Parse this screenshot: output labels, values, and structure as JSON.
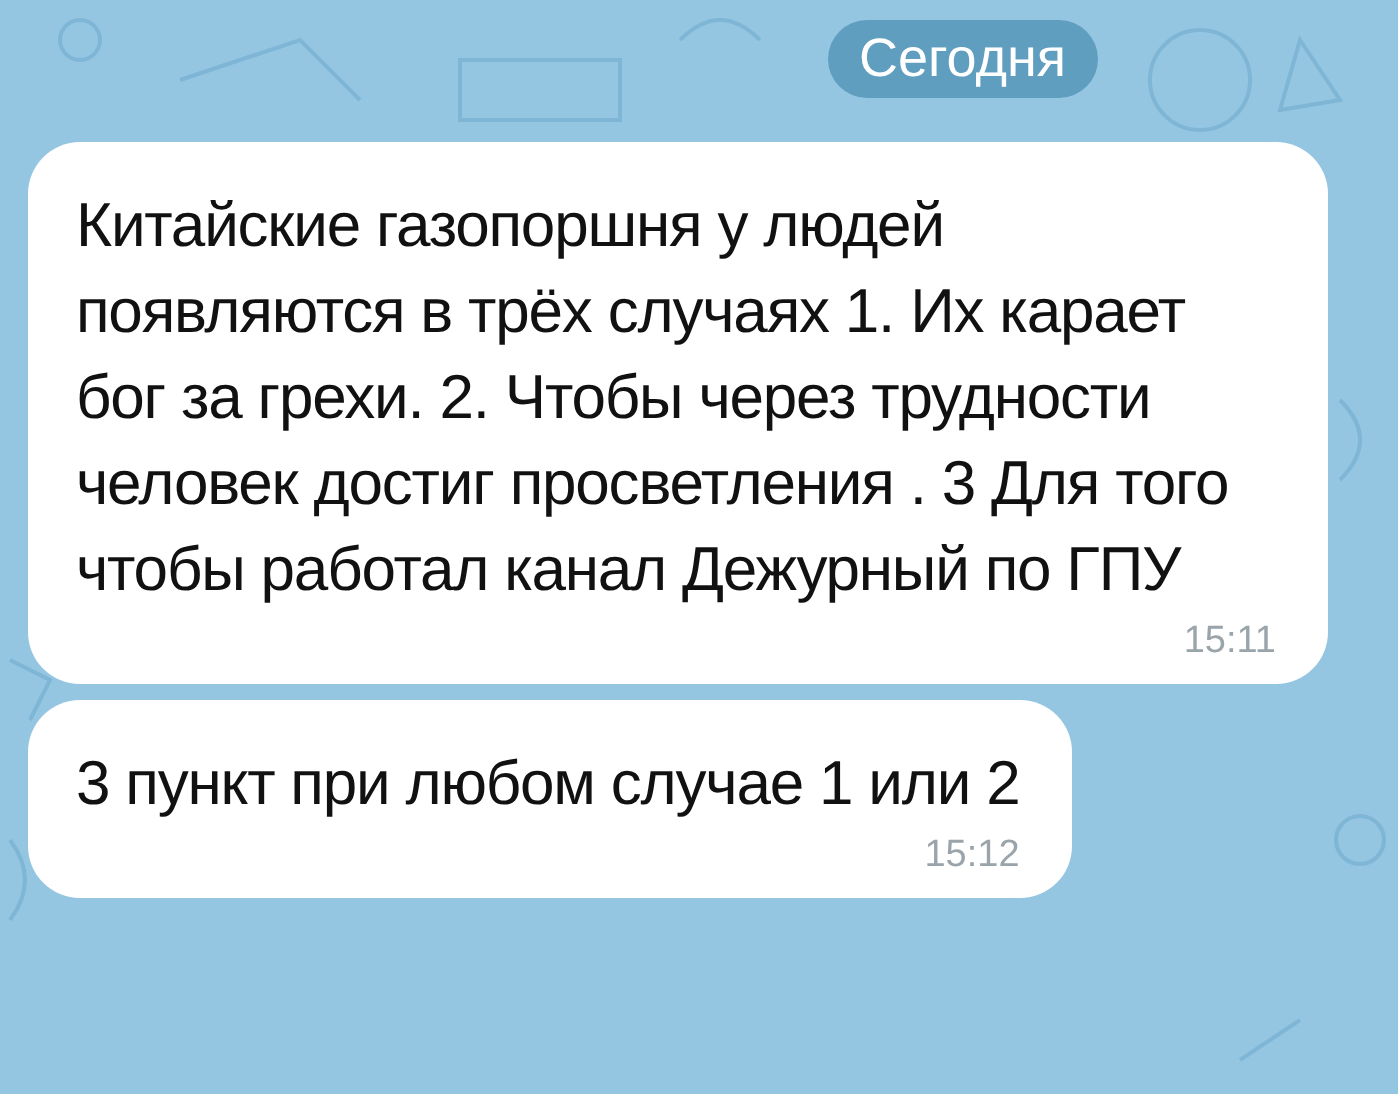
{
  "date_badge": "Сегодня",
  "messages": [
    {
      "text": "Китайские газопоршня у людей появляются в трёх случаях 1. Их карает бог за грехи. 2. Чтобы через трудности человек достиг просветления . 3 Для того чтобы работал канал Дежурный по ГПУ",
      "time": "15:11"
    },
    {
      "text": "3 пункт при любом случае 1 или 2",
      "time": "15:12"
    }
  ]
}
